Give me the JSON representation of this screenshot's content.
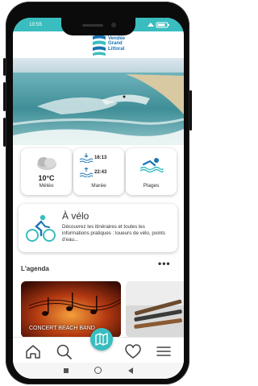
{
  "status": {
    "time": "10:55",
    "indicators": "⚙"
  },
  "brand": {
    "line1": "Vendée",
    "line2": "Grand",
    "line3": "Littoral"
  },
  "tiles": {
    "meteo": {
      "temp": "10°C",
      "label": "Météo"
    },
    "maree": {
      "high_time": "16:13",
      "low_time": "22:43",
      "label": "Marée"
    },
    "plages": {
      "label": "Plages"
    }
  },
  "velo": {
    "title": "À vélo",
    "description": "Découvrez les itinéraires et toutes les informations pratiques : loueurs de vélo, points d'eau..."
  },
  "agenda": {
    "title": "L'agenda",
    "more": "•••",
    "cards": [
      {
        "label": "CONCERT BEACH BAND"
      },
      {
        "label": ""
      }
    ]
  },
  "colors": {
    "accent": "#39bdbf",
    "brand_blue": "#1a74b3"
  },
  "icons": [
    "home-icon",
    "search-icon",
    "map-icon",
    "heart-icon",
    "menu-icon"
  ]
}
